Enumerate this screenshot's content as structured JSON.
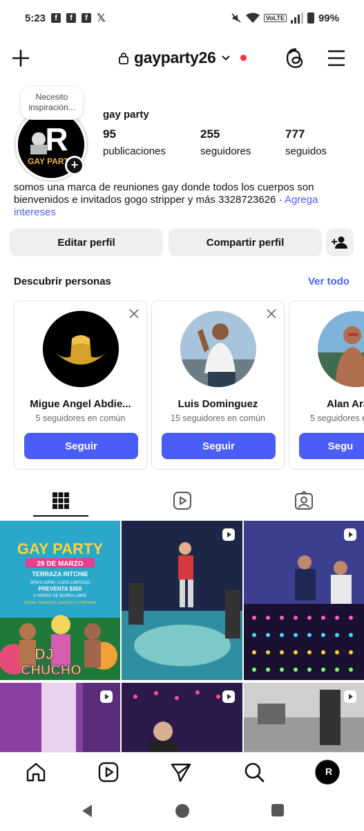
{
  "status_bar": {
    "time": "5:23",
    "fb_icon_glyph": "f",
    "x_icon_glyph": "𝕏",
    "volte": "VoLTE",
    "battery": "99%"
  },
  "header": {
    "username": "gayparty26",
    "icons": [
      "plus-icon",
      "lock-icon",
      "chevron-down-icon",
      "threads-icon",
      "menu-icon"
    ]
  },
  "profile": {
    "note": "Necesito inspiración...",
    "display_name": "gay party",
    "avatar_text": "GAY PARTY",
    "avatar_initial": "R",
    "add_story_glyph": "+",
    "stats": [
      {
        "value": "95",
        "label": "publicaciones"
      },
      {
        "value": "255",
        "label": "seguidores"
      },
      {
        "value": "777",
        "label": "seguidos"
      }
    ],
    "bio": "somos una marca de reuniones gay donde todos los cuerpos son bienvenidos e invitados gogo stripper y más 3328723626 · ",
    "bio_link": "Agrega intereses"
  },
  "actions": {
    "edit_profile": "Editar perfil",
    "share_profile": "Compartir perfil"
  },
  "discover": {
    "title": "Descubrir personas",
    "see_all": "Ver todo",
    "cards": [
      {
        "name": "Migue Angel Abdie...",
        "mutual": "5 seguidores en común",
        "follow": "Seguir"
      },
      {
        "name": "Luis Dominguez",
        "mutual": "15 seguidores en común",
        "follow": "Seguir"
      },
      {
        "name": "Alan Ara",
        "mutual": "5 seguidores e",
        "follow": "Segu"
      }
    ]
  },
  "tabs": [
    "grid-icon",
    "reels-icon",
    "tagged-icon"
  ],
  "posts": {
    "poster_lines": [
      "GAY PARTY",
      "29 DE MARZO",
      "TERRAZA RITCHIE",
      "3PM A 10PM | CUPO LIMITADO",
      "PREVENTA $350",
      "2 HORAS DE BARRA LIBRE",
      "SHOW: TRAVESTI, GOGOS Y STRIPPER",
      "DJ",
      "CHUCHO"
    ]
  },
  "bottom_nav": [
    "home-icon",
    "reels-icon",
    "send-icon",
    "search-icon",
    "profile-avatar"
  ],
  "colors": {
    "accent": "#4a5df9",
    "button_gray": "#efefef",
    "red_dot": "#ff3040"
  }
}
